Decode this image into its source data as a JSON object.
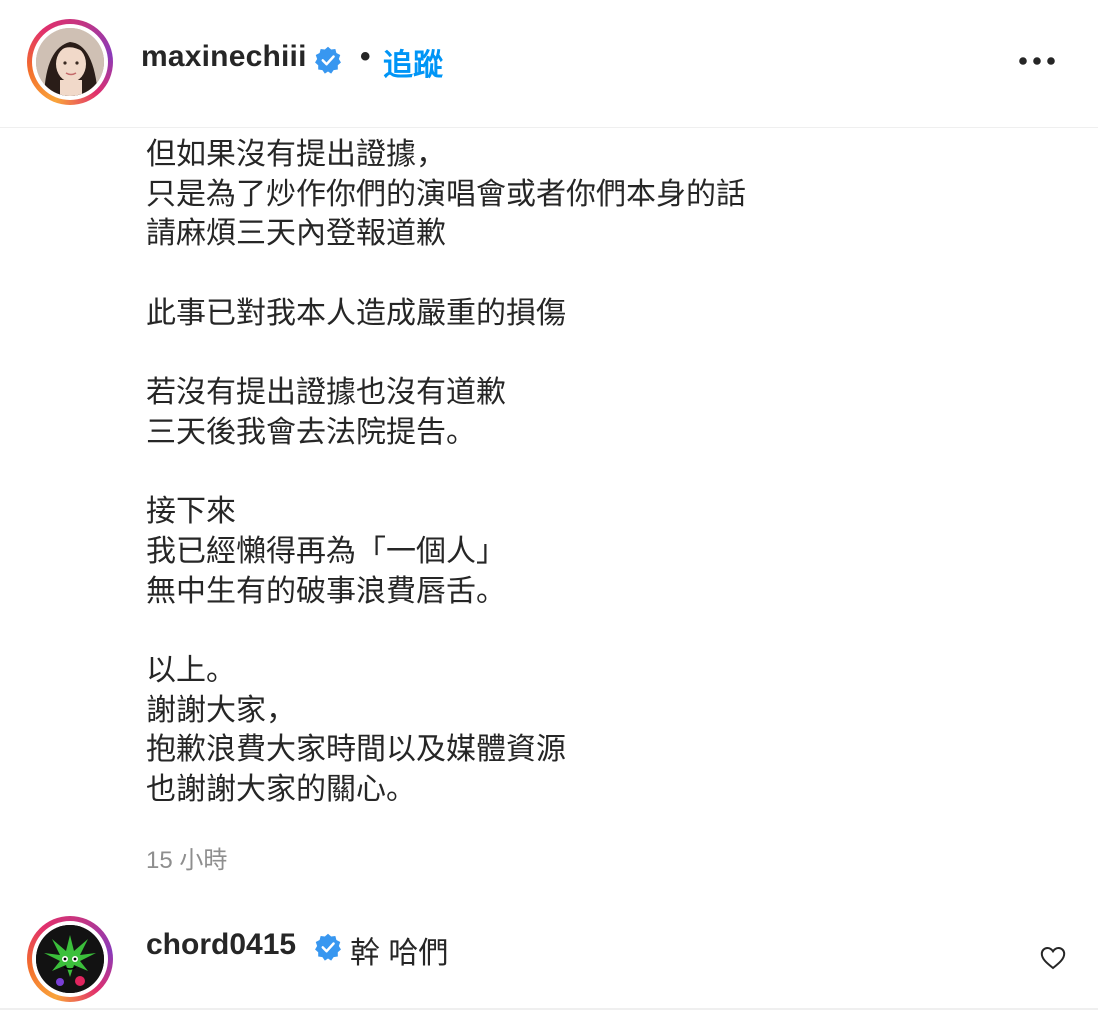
{
  "post": {
    "author": "maxinechiii",
    "separator": "•",
    "follow_label": "追蹤",
    "caption_lines": [
      "但如果沒有提出證據，",
      "只是為了炒作你們的演唱會或者你們本身的話",
      "請麻煩三天內登報道歉",
      "",
      "此事已對我本人造成嚴重的損傷",
      "",
      "若沒有提出證據也沒有道歉",
      "三天後我會去法院提告。",
      "",
      "接下來",
      "我已經懶得再為「一個人」",
      "無中生有的破事浪費唇舌。",
      "",
      "以上。",
      "謝謝大家，",
      "抱歉浪費大家時間以及媒體資源",
      "也謝謝大家的關心。"
    ],
    "timestamp": "15 小時"
  },
  "comment": {
    "author": "chord0415",
    "text": "幹 哈們"
  },
  "colors": {
    "link_blue": "#0095f6",
    "text": "#262626",
    "muted": "#8e8e8e",
    "verified_blue": "#3897f0"
  },
  "icons": {
    "verified": "verified-badge-icon",
    "more": "more-options-icon",
    "like": "heart-icon"
  }
}
